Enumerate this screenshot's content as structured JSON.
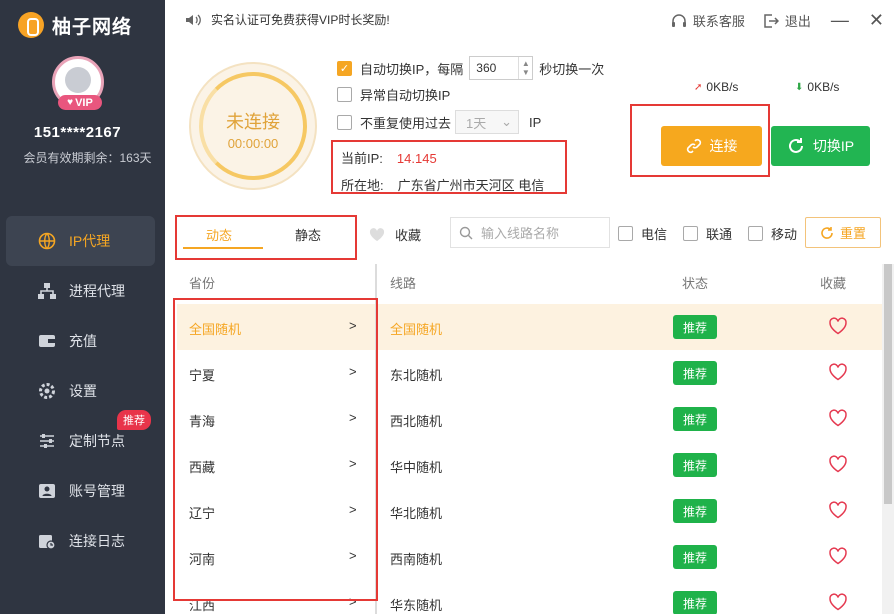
{
  "app": {
    "name": "柚子网络"
  },
  "user": {
    "vip_label": "VIP",
    "phone": "151****2167",
    "member_validity": "会员有效期剩余：163天"
  },
  "sidebar": {
    "items": [
      {
        "label": "IP代理",
        "icon": "globe-icon",
        "active": true
      },
      {
        "label": "进程代理",
        "icon": "network-icon"
      },
      {
        "label": "充值",
        "icon": "wallet-icon"
      },
      {
        "label": "设置",
        "icon": "gear-icon"
      },
      {
        "label": "定制节点",
        "icon": "sliders-icon",
        "badge": "推荐"
      },
      {
        "label": "账号管理",
        "icon": "user-card-icon"
      },
      {
        "label": "连接日志",
        "icon": "calendar-log-icon"
      }
    ]
  },
  "header": {
    "notice": "实名认证可免费获得VIP时长奖励!",
    "support": "联系客服",
    "logout": "退出",
    "minimize": "—",
    "close": "✕"
  },
  "status_ring": {
    "state": "未连接",
    "timer": "00:00:00"
  },
  "options": {
    "auto_switch": {
      "label": "自动切换IP，每隔",
      "value": "360",
      "suffix": "秒切换一次",
      "checked": true
    },
    "auto_switch_on_error": {
      "label": "异常自动切换IP",
      "checked": false
    },
    "no_repeat": {
      "label": "不重复使用过去",
      "select_value": "1天",
      "suffix": "IP",
      "checked": false
    }
  },
  "ip_info": {
    "current_ip_label": "当前IP:",
    "current_ip": "14.145",
    "location_label": "所在地:",
    "location": "广东省广州市天河区 电信"
  },
  "speed": {
    "upload": "0KB/s",
    "download": "0KB/s"
  },
  "buttons": {
    "connect": "连接",
    "switch_ip": "切换IP",
    "reset": "重置"
  },
  "filters": {
    "tabs": [
      "动态",
      "静态"
    ],
    "favorite": "收藏",
    "search_placeholder": "输入线路名称",
    "isps": [
      "电信",
      "联通",
      "移动"
    ]
  },
  "table": {
    "headers": {
      "province": "省份",
      "line": "线路",
      "status": "状态",
      "favorite": "收藏"
    },
    "provinces": [
      "全国随机",
      "宁夏",
      "青海",
      "西藏",
      "辽宁",
      "河南",
      "江西"
    ],
    "lines": [
      {
        "name": "全国随机",
        "status": "推荐"
      },
      {
        "name": "东北随机",
        "status": "推荐"
      },
      {
        "name": "西北随机",
        "status": "推荐"
      },
      {
        "name": "华中随机",
        "status": "推荐"
      },
      {
        "name": "华北随机",
        "status": "推荐"
      },
      {
        "name": "西南随机",
        "status": "推荐"
      },
      {
        "name": "华东随机",
        "status": "推荐"
      }
    ],
    "chevron": ">"
  },
  "colors": {
    "accent": "#f5a623",
    "green": "#1fb24a",
    "sidebar": "#2f3541",
    "highlight": "#e53935"
  }
}
